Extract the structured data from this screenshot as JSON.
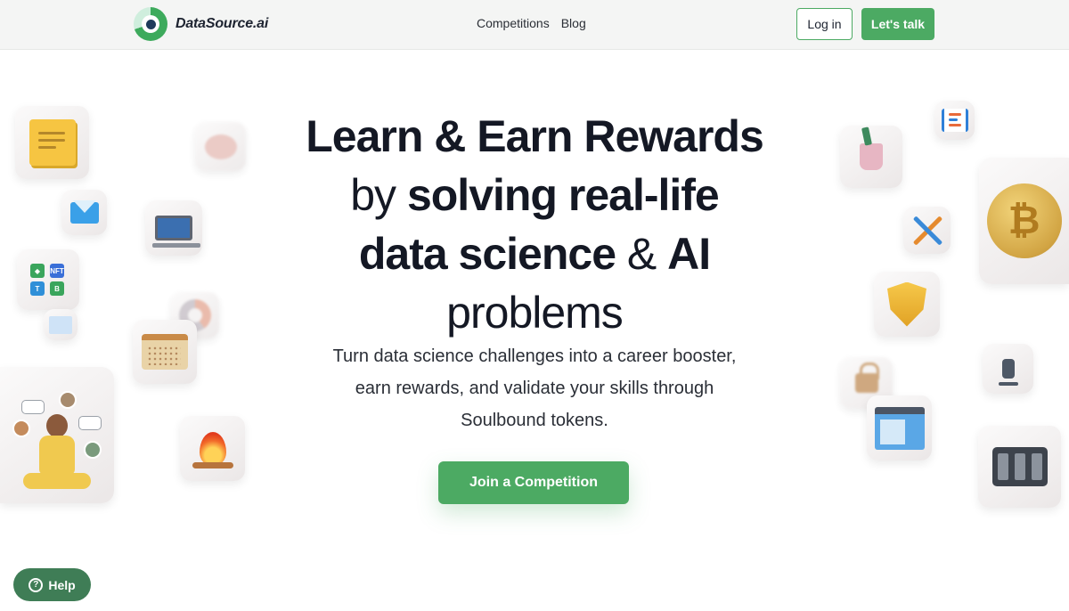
{
  "brand": {
    "name": "DataSource.ai",
    "logo_icon": "datasource-logo-icon"
  },
  "nav": {
    "links": [
      "Competitions",
      "Blog"
    ],
    "login_label": "Log in",
    "talk_label": "Let's talk"
  },
  "hero": {
    "line1": "Learn & Earn Rewards",
    "line2_thin": "by ",
    "line2_bold": "solving real-life",
    "line3_bold": "data science",
    "line3_thin": " & ",
    "line3_bold2": "AI",
    "line4_thin": "problems",
    "subtitle": "Turn data science challenges into a career booster, earn rewards, and validate your skills through Soulbound tokens.",
    "cta_label": "Join a Competition"
  },
  "help": {
    "label": "Help",
    "glyph": "?"
  },
  "crypto_tile": {
    "labels": [
      "NFT",
      "T",
      "B"
    ]
  },
  "coin": {
    "glyph": "₿"
  },
  "colors": {
    "primary": "#4caa63",
    "help_bg": "#3f7d56",
    "text_dark": "#141824",
    "nav_bg": "#f4f5f4"
  }
}
